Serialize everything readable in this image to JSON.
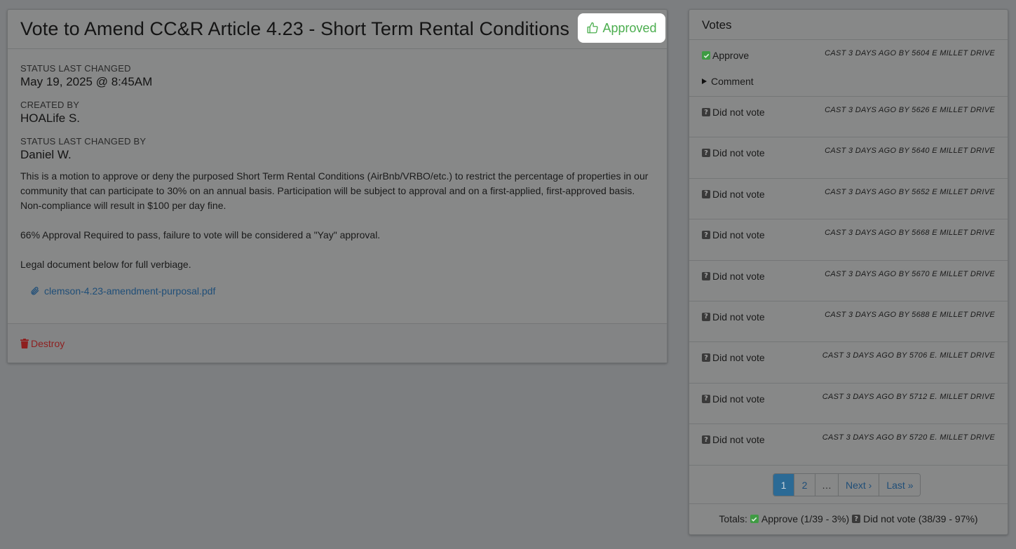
{
  "main": {
    "title": "Vote to Amend CC&R Article 4.23 - Short Term Rental Conditions",
    "status_label": "Approved",
    "fields": [
      {
        "label": "STATUS LAST CHANGED",
        "value": "May 19, 2025 @ 8:45AM"
      },
      {
        "label": "CREATED BY",
        "value": "HOALife S."
      },
      {
        "label": "STATUS LAST CHANGED BY",
        "value": "Daniel W."
      }
    ],
    "description": [
      "This is a motion to approve or deny the purposed Short Term Rental Conditions (AirBnb/VRBO/etc.) to restrict the percentage of properties in our community that can participate to 30% on an annual basis. Participation will be subject to approval and on a first-applied, first-approved basis. Non-compliance will result in $100 per day fine.",
      "66% Approval Required to pass, failure to vote will be considered a \"Yay\" approval.",
      "Legal document below for full verbiage."
    ],
    "attachment": "clemson-4.23-amendment-purposal.pdf",
    "destroy_label": "Destroy"
  },
  "votes": {
    "title": "Votes",
    "comment_label": "Comment",
    "rows": [
      {
        "choice": "Approve",
        "cast": "CAST 3 DAYS AGO BY 5604 E MILLET DRIVE"
      },
      {
        "choice": "Did not vote",
        "cast": "CAST 3 DAYS AGO BY 5626 E MILLET DRIVE"
      },
      {
        "choice": "Did not vote",
        "cast": "CAST 3 DAYS AGO BY 5640 E MILLET DRIVE"
      },
      {
        "choice": "Did not vote",
        "cast": "CAST 3 DAYS AGO BY 5652 E MILLET DRIVE"
      },
      {
        "choice": "Did not vote",
        "cast": "CAST 3 DAYS AGO BY 5668 E MILLET DRIVE"
      },
      {
        "choice": "Did not vote",
        "cast": "CAST 3 DAYS AGO BY 5670 E MILLET DRIVE"
      },
      {
        "choice": "Did not vote",
        "cast": "CAST 3 DAYS AGO BY 5688 E MILLET DRIVE"
      },
      {
        "choice": "Did not vote",
        "cast": "CAST 3 DAYS AGO BY 5706 E. MILLET DRIVE"
      },
      {
        "choice": "Did not vote",
        "cast": "CAST 3 DAYS AGO BY 5712 E. MILLET DRIVE"
      },
      {
        "choice": "Did not vote",
        "cast": "CAST 3 DAYS AGO BY 5720 E. MILLET DRIVE"
      }
    ],
    "pagination": {
      "page1": "1",
      "page2": "2",
      "ellipsis": "…",
      "next": "Next ›",
      "last": "Last »"
    },
    "totals": {
      "prefix": "Totals:",
      "approve": "Approve (1/39 - 3%)",
      "did_not_vote": "Did not vote (38/39 - 97%)"
    }
  },
  "colors": {
    "approved_green": "#4cae4f",
    "destroy_red": "#8e1f1f",
    "link_blue": "#1f4e78",
    "pager_active": "#2b6a95"
  }
}
